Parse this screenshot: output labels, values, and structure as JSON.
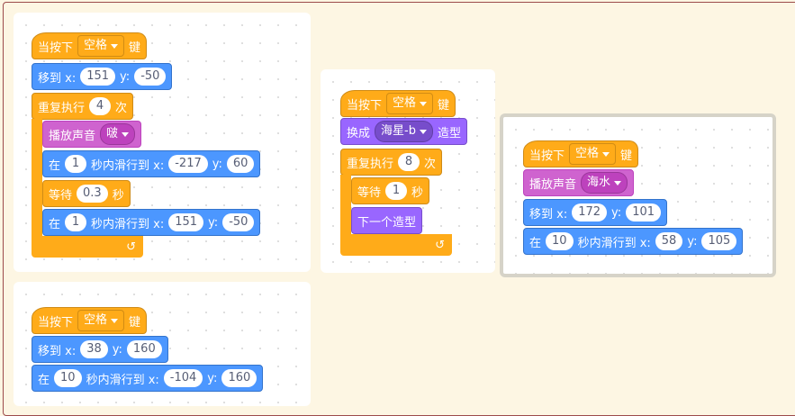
{
  "labels": {
    "when_key": "当按下",
    "key_suffix": "键",
    "goto": "移到 x:",
    "y": "y:",
    "repeat": "重复执行",
    "times": "次",
    "play_sound": "播放声音",
    "glide_in": "在",
    "glide_mid": "秒内滑行到 x:",
    "wait": "等待",
    "seconds": "秒",
    "switch_costume": "换成",
    "costume": "造型",
    "next_costume": "下一个造型",
    "loop_arrow": "↺"
  },
  "scripts": [
    {
      "key": "空格",
      "goto": {
        "x": "151",
        "y": "-50"
      },
      "repeat": "4",
      "sound": "啵",
      "glide1": {
        "secs": "1",
        "x": "-217",
        "y": "60"
      },
      "wait": "0.3",
      "glide2": {
        "secs": "1",
        "x": "151",
        "y": "-50"
      }
    },
    {
      "key": "空格",
      "costume": "海星-b",
      "repeat": "8",
      "wait": "1"
    },
    {
      "key": "空格",
      "sound": "海水",
      "goto": {
        "x": "172",
        "y": "101"
      },
      "glide": {
        "secs": "10",
        "x": "58",
        "y": "105"
      }
    },
    {
      "key": "空格",
      "goto": {
        "x": "38",
        "y": "160"
      },
      "glide": {
        "secs": "10",
        "x": "-104",
        "y": "160"
      }
    }
  ]
}
